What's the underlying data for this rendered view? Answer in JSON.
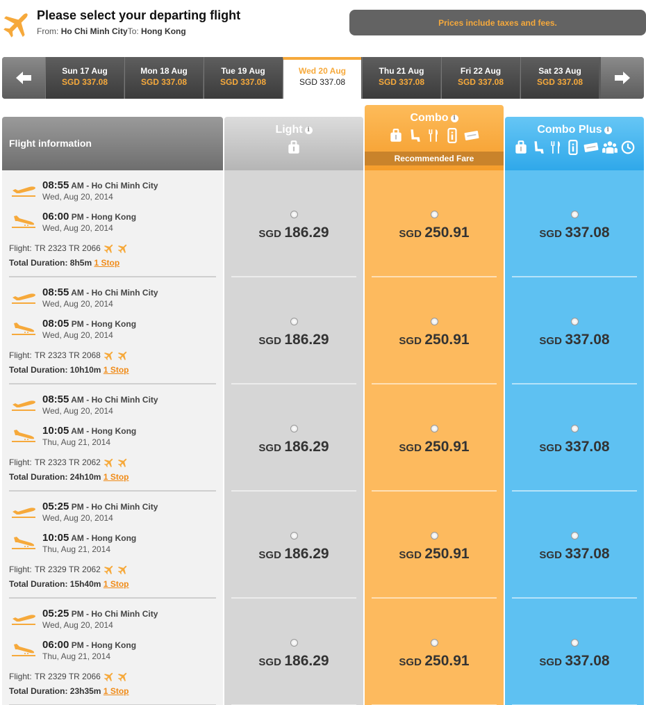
{
  "header": {
    "title": "Please select your departing flight",
    "from_label": "From:",
    "from_city": "Ho Chi Minh City",
    "to_label": "To:",
    "to_city": "Hong Kong",
    "tax_note": "Prices include taxes and fees."
  },
  "dates": [
    {
      "day": "Sun 17 Aug",
      "price": "SGD 337.08"
    },
    {
      "day": "Mon 18 Aug",
      "price": "SGD 337.08"
    },
    {
      "day": "Tue 19 Aug",
      "price": "SGD 337.08"
    },
    {
      "day": "Wed 20 Aug",
      "price": "SGD 337.08",
      "selected": true
    },
    {
      "day": "Thu 21 Aug",
      "price": "SGD 337.08"
    },
    {
      "day": "Fri 22 Aug",
      "price": "SGD 337.08"
    },
    {
      "day": "Sat 23 Aug",
      "price": "SGD 337.08"
    }
  ],
  "columns": {
    "info": "Flight information",
    "light": "Light",
    "combo": "Combo",
    "combo_badge": "Recommended Fare",
    "plus": "Combo Plus"
  },
  "labels": {
    "flight": "Flight:",
    "duration": "Total Duration:",
    "currency": "SGD"
  },
  "colors": {
    "accent_orange": "#f6a93b",
    "combo": "#fdba5e",
    "plus": "#5ec1f2",
    "light": "#d6d6d6"
  },
  "flights": [
    {
      "dep_time": "08:55",
      "dep_ampm": "AM",
      "dep_city": "Ho Chi Minh City",
      "dep_date": "Wed, Aug 20, 2014",
      "arr_time": "06:00",
      "arr_ampm": "PM",
      "arr_city": "Hong Kong",
      "arr_date": "Wed, Aug 20, 2014",
      "flight_no": "TR 2323 TR 2066",
      "duration": "8h5m",
      "stops": "1 Stop",
      "light": "186.29",
      "combo": "250.91",
      "plus": "337.08"
    },
    {
      "dep_time": "08:55",
      "dep_ampm": "AM",
      "dep_city": "Ho Chi Minh City",
      "dep_date": "Wed, Aug 20, 2014",
      "arr_time": "08:05",
      "arr_ampm": "PM",
      "arr_city": "Hong Kong",
      "arr_date": "Wed, Aug 20, 2014",
      "flight_no": "TR 2323 TR 2068",
      "duration": "10h10m",
      "stops": "1 Stop",
      "light": "186.29",
      "combo": "250.91",
      "plus": "337.08"
    },
    {
      "dep_time": "08:55",
      "dep_ampm": "AM",
      "dep_city": "Ho Chi Minh City",
      "dep_date": "Wed, Aug 20, 2014",
      "arr_time": "10:05",
      "arr_ampm": "AM",
      "arr_city": "Hong Kong",
      "arr_date": "Thu, Aug 21, 2014",
      "flight_no": "TR 2323 TR 2062",
      "duration": "24h10m",
      "stops": "1 Stop",
      "light": "186.29",
      "combo": "250.91",
      "plus": "337.08"
    },
    {
      "dep_time": "05:25",
      "dep_ampm": "PM",
      "dep_city": "Ho Chi Minh City",
      "dep_date": "Wed, Aug 20, 2014",
      "arr_time": "10:05",
      "arr_ampm": "AM",
      "arr_city": "Hong Kong",
      "arr_date": "Thu, Aug 21, 2014",
      "flight_no": "TR 2329 TR 2062",
      "duration": "15h40m",
      "stops": "1 Stop",
      "light": "186.29",
      "combo": "250.91",
      "plus": "337.08"
    },
    {
      "dep_time": "05:25",
      "dep_ampm": "PM",
      "dep_city": "Ho Chi Minh City",
      "dep_date": "Wed, Aug 20, 2014",
      "arr_time": "06:00",
      "arr_ampm": "PM",
      "arr_city": "Hong Kong",
      "arr_date": "Thu, Aug 21, 2014",
      "flight_no": "TR 2329 TR 2066",
      "duration": "23h35m",
      "stops": "1 Stop",
      "light": "186.29",
      "combo": "250.91",
      "plus": "337.08"
    }
  ]
}
